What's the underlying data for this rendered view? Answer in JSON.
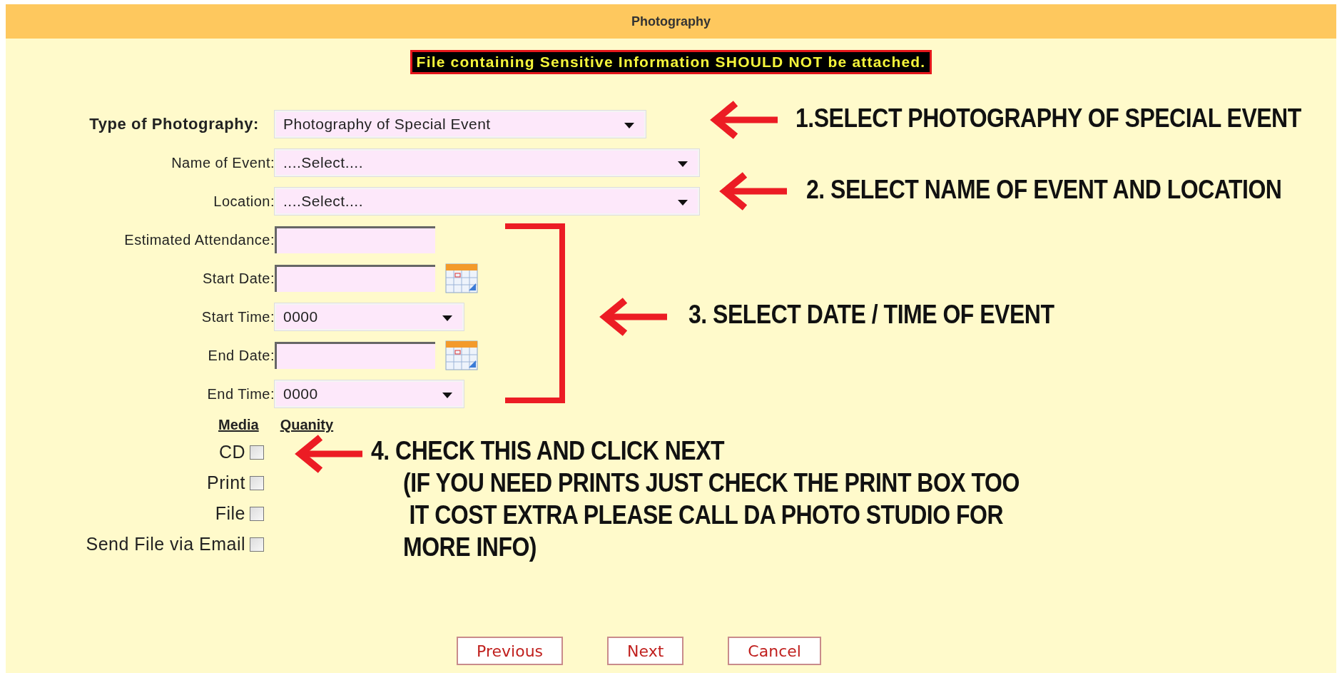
{
  "header": {
    "title": "Photography"
  },
  "warning": "File containing Sensitive Information SHOULD NOT be attached.",
  "fields": [
    {
      "kind": "select",
      "label": "Type of Photography:",
      "value": "Photography of Special Event",
      "emphasis": true
    },
    {
      "kind": "select",
      "label": "Name of Event:",
      "value": "....Select....",
      "emphasis": false
    },
    {
      "kind": "select",
      "label": "Location:",
      "value": "....Select....",
      "emphasis": false
    },
    {
      "kind": "text",
      "label": "Estimated Attendance:",
      "emphasis": false
    },
    {
      "kind": "date",
      "label": "Start Date:",
      "emphasis": false
    },
    {
      "kind": "select",
      "label": "Start Time:",
      "value": "0000",
      "emphasis": false
    },
    {
      "kind": "date",
      "label": "End Date:",
      "emphasis": false
    },
    {
      "kind": "select",
      "label": "End Time:",
      "value": "0000",
      "emphasis": false
    }
  ],
  "media": {
    "headings": [
      "Media",
      "Quanity"
    ],
    "options": [
      {
        "label": "CD",
        "checked": false
      },
      {
        "label": "Print",
        "checked": false
      },
      {
        "label": "File",
        "checked": false
      },
      {
        "label": "Send File via Email",
        "checked": false
      }
    ]
  },
  "buttons": [
    "Previous",
    "Next",
    "Cancel"
  ],
  "annotations": [
    {
      "lines": [
        "1.SELECT PHOTOGRAPHY OF SPECIAL EVENT"
      ]
    },
    {
      "lines": [
        "2. SELECT NAME OF EVENT AND LOCATION"
      ]
    },
    {
      "lines": [
        "3. SELECT DATE / TIME OF EVENT"
      ]
    },
    {
      "lines": [
        "4. CHECK THIS AND CLICK NEXT",
        "(IF YOU NEED PRINTS JUST CHECK THE PRINT BOX TOO",
        " IT COST EXTRA PLEASE CALL DA PHOTO STUDIO FOR",
        "MORE INFO)"
      ]
    }
  ]
}
